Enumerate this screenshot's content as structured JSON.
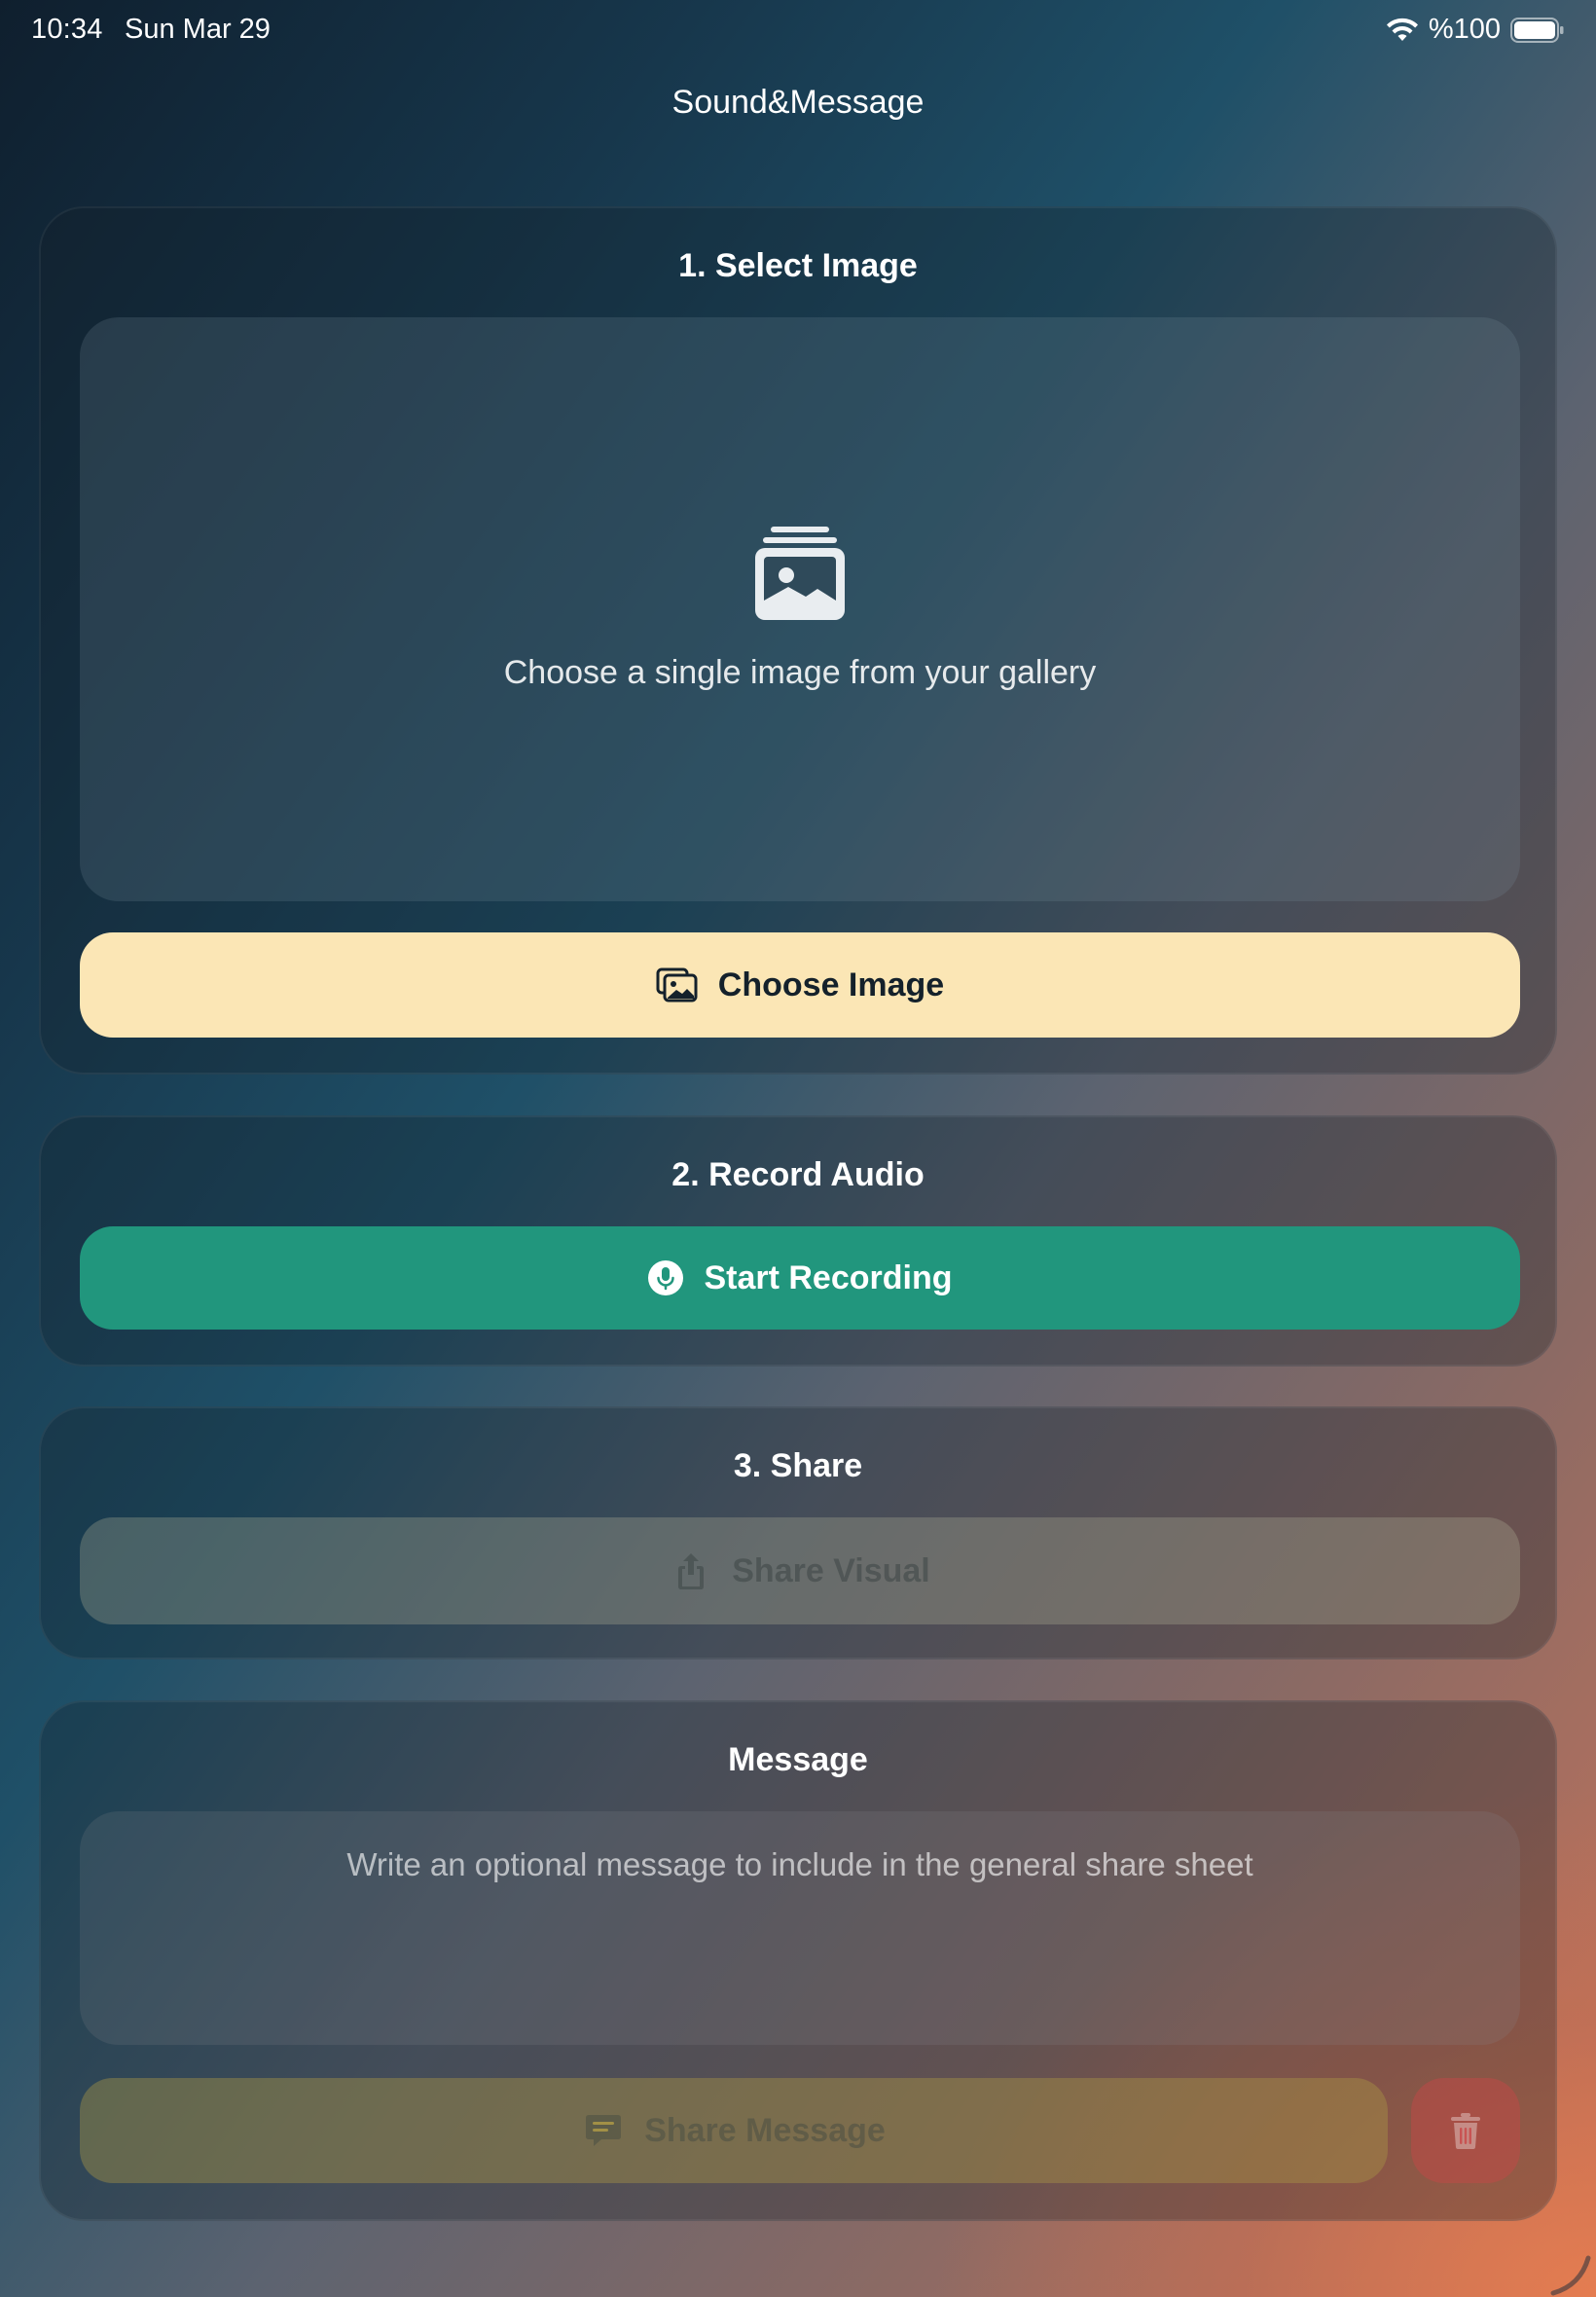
{
  "status_bar": {
    "time": "10:34",
    "date": "Sun Mar 29",
    "battery": "%100"
  },
  "app": {
    "title": "Sound&Message"
  },
  "select_image": {
    "title": "1. Select Image",
    "hint": "Choose a single image from your gallery",
    "button_label": "Choose Image",
    "icon": "photo-stack-icon"
  },
  "record_audio": {
    "title": "2. Record Audio",
    "button_label": "Start Recording",
    "icon": "mic-circle-icon"
  },
  "share": {
    "title": "3. Share",
    "button_label": "Share Visual",
    "icon": "share-icon",
    "enabled": false
  },
  "message": {
    "title": "Message",
    "placeholder": "Write an optional message to include in the general share sheet",
    "value": "",
    "share_button_label": "Share Message",
    "share_icon": "message-bubble-icon",
    "delete_icon": "trash-icon",
    "enabled": false
  },
  "colors": {
    "choose_button": "#fbe6b5",
    "record_button": "#21967d",
    "delete_button": "#c84646"
  }
}
